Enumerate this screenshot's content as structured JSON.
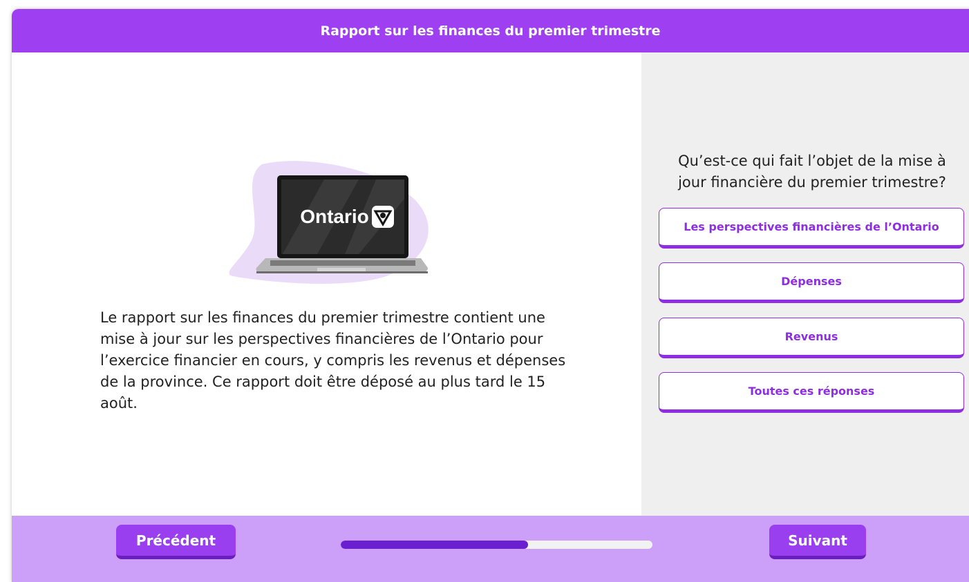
{
  "header": {
    "title": "Rapport sur les finances du premier trimestre"
  },
  "illustration": {
    "screen_text": "Ontario",
    "logo_icon": "ontario-trillium-icon"
  },
  "content": {
    "paragraph": "Le rapport sur les finances du premier trimestre contient une mise à jour sur les perspectives financières de l’Ontario pour l’exercice financier en cours, y compris les revenus et dépenses de la province. Ce rapport doit être déposé au plus tard le 15 août."
  },
  "quiz": {
    "question": "Qu’est-ce qui fait l’objet de la mise à jour financière du premier trimestre?",
    "answers": [
      "Les perspectives financières de l’Ontario",
      "Dépenses",
      "Revenus",
      "Toutes ces réponses"
    ]
  },
  "footer": {
    "prev_label": "Précédent",
    "next_label": "Suivant",
    "progress": 0.6
  },
  "colors": {
    "accent": "#9f3ff2",
    "footer_bg": "#cc9ff8",
    "progress_fill": "#6a1fd0"
  }
}
